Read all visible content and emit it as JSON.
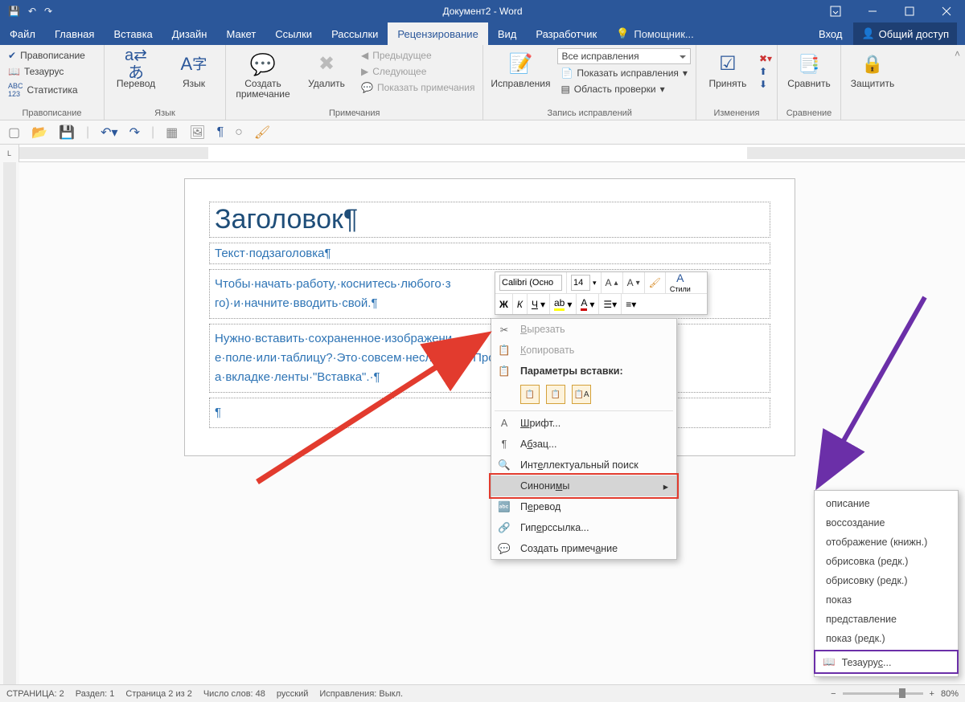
{
  "title": "Документ2 - Word",
  "tabs": [
    "Файл",
    "Главная",
    "Вставка",
    "Дизайн",
    "Макет",
    "Ссылки",
    "Рассылки",
    "Рецензирование",
    "Вид",
    "Разработчик"
  ],
  "tell_me": "Помощник...",
  "login": "Вход",
  "share": "Общий доступ",
  "ribbon": {
    "spelling": {
      "spellcheck": "Правописание",
      "thesaurus": "Тезаурус",
      "stats": "Статистика",
      "label": "Правописание"
    },
    "language": {
      "translate": "Перевод",
      "lang": "Язык",
      "label": "Язык"
    },
    "comments": {
      "new": "Создать примечание",
      "delete": "Удалить",
      "prev": "Предыдущее",
      "next": "Следующее",
      "show": "Показать примечания",
      "label": "Примечания"
    },
    "tracking": {
      "track": "Исправления",
      "mode": "Все исправления",
      "show": "Показать исправления",
      "pane": "Область проверки",
      "label": "Запись исправлений"
    },
    "changes": {
      "accept": "Принять",
      "label": "Изменения"
    },
    "compare": {
      "compare": "Сравнить",
      "label": "Сравнение"
    },
    "protect": {
      "protect": "Защитить"
    }
  },
  "doc": {
    "h1": "Заголовок¶",
    "sub": "Текст·подзаголовка¶",
    "p1a": "Чтобы·начать·работу,·коснитесь·любого·з",
    "p1b": "го)·и·начните·вводить·свой.¶",
    "p2a": "Нужно·вставить·сохраненное·изображени",
    "p2b": "е·поле·или·таблицу?·Это·совсем·несложно",
    "p2c": "Просто·в",
    "p2d": "а·вкладке·ленты·\"Вставка\".·¶",
    "p3": "¶"
  },
  "minibar": {
    "font": "Calibri (Осно",
    "size": "14",
    "styles": "Стили"
  },
  "context": {
    "cut": "Вырезать",
    "copy": "Копировать",
    "pasteopts": "Параметры вставки:",
    "font": "Шрифт...",
    "para": "Абзац...",
    "smart": "Интеллектуальный поиск",
    "synonyms": "Синонимы",
    "translate": "Перевод",
    "hyperlink": "Гиперссылка...",
    "comment": "Создать примечание"
  },
  "synonyms": [
    "описание",
    "воссоздание",
    "отображение (книжн.)",
    "обрисовка (редк.)",
    "обрисовку (редк.)",
    "показ",
    "представление",
    "показ (редк.)"
  ],
  "thesaurus_item": "Тезаурус...",
  "status": {
    "page": "СТРАНИЦА: 2",
    "section": "Раздел: 1",
    "pageof": "Страница 2 из 2",
    "words": "Число слов: 48",
    "lang": "русский",
    "track": "Исправления: Выкл.",
    "zoom": "80%"
  },
  "ruler_corner": "L"
}
